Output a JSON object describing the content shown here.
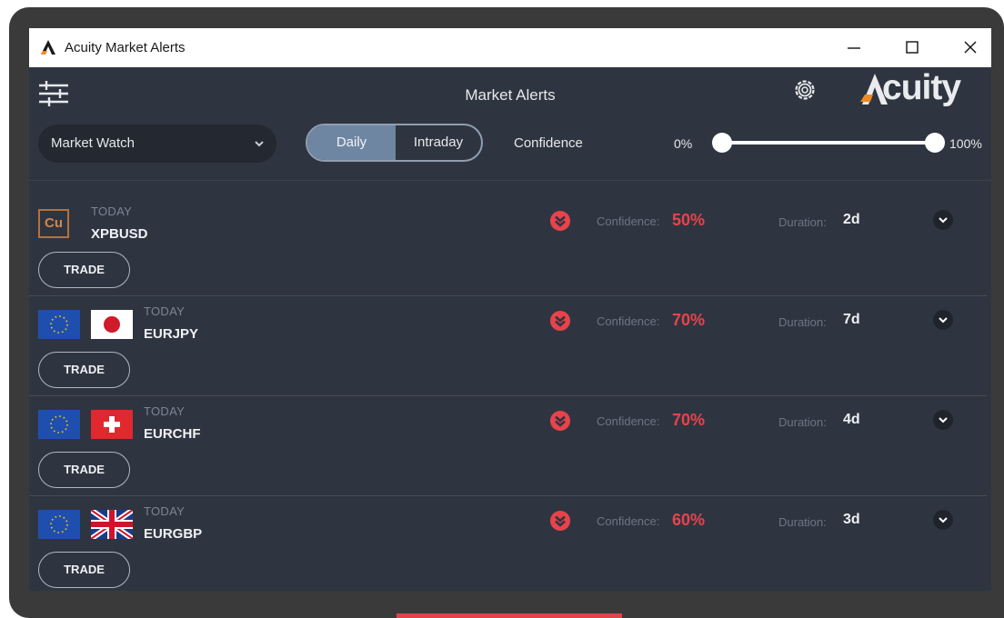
{
  "window": {
    "title": "Acuity Market Alerts"
  },
  "header": {
    "title": "Market Alerts",
    "logo_text": "cuity",
    "logo_mark": "A"
  },
  "filters": {
    "watchlist_value": "Market Watch",
    "timeframe_options": [
      "Daily",
      "Intraday"
    ],
    "timeframe_selected": "Daily",
    "confidence_label": "Confidence",
    "confidence_min_label": "0%",
    "confidence_max_label": "100%",
    "confidence_range": [
      0,
      100
    ]
  },
  "labels": {
    "confidence": "Confidence:",
    "duration": "Duration:",
    "trade": "TRADE"
  },
  "alerts": [
    {
      "when": "TODAY",
      "symbol": "XPBUSD",
      "icon": "Cu",
      "direction": "down",
      "confidence": "50%",
      "duration": "2d"
    },
    {
      "when": "TODAY",
      "symbol": "EURJPY",
      "flags": [
        "eu-flag-icon",
        "japan-flag-icon"
      ],
      "direction": "down",
      "confidence": "70%",
      "duration": "7d"
    },
    {
      "when": "TODAY",
      "symbol": "EURCHF",
      "flags": [
        "eu-flag-icon",
        "swiss-flag-icon"
      ],
      "direction": "down",
      "confidence": "70%",
      "duration": "4d"
    },
    {
      "when": "TODAY",
      "symbol": "EURGBP",
      "flags": [
        "eu-flag-icon",
        "uk-flag-icon"
      ],
      "direction": "down",
      "confidence": "60%",
      "duration": "3d"
    }
  ],
  "colors": {
    "background": "#2f3540",
    "bearish": "#e8434b",
    "toggle_active": "#6f86a3",
    "copper": "#d0874a"
  }
}
